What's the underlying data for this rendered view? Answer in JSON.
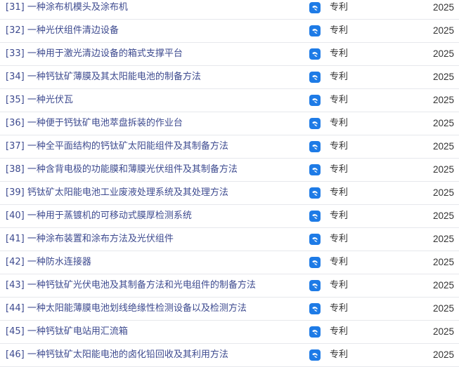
{
  "records": [
    {
      "index": "[31]",
      "title": "一种涂布机模头及涂布机",
      "type_icon": "patent-icon",
      "type": "专利",
      "year": "2025"
    },
    {
      "index": "[32]",
      "title": "一种光伏组件清边设备",
      "type_icon": "patent-icon",
      "type": "专利",
      "year": "2025"
    },
    {
      "index": "[33]",
      "title": "一种用于激光清边设备的箱式支撑平台",
      "type_icon": "patent-icon",
      "type": "专利",
      "year": "2025"
    },
    {
      "index": "[34]",
      "title": "一种钙钛矿薄膜及其太阳能电池的制备方法",
      "type_icon": "patent-icon",
      "type": "专利",
      "year": "2025"
    },
    {
      "index": "[35]",
      "title": "一种光伏瓦",
      "type_icon": "patent-icon",
      "type": "专利",
      "year": "2025"
    },
    {
      "index": "[36]",
      "title": "一种便于钙钛矿电池萃盘拆装的作业台",
      "type_icon": "patent-icon",
      "type": "专利",
      "year": "2025"
    },
    {
      "index": "[37]",
      "title": "一种全平面结构的钙钛矿太阳能组件及其制备方法",
      "type_icon": "patent-icon",
      "type": "专利",
      "year": "2025"
    },
    {
      "index": "[38]",
      "title": "一种含背电极的功能膜和薄膜光伏组件及其制备方法",
      "type_icon": "patent-icon",
      "type": "专利",
      "year": "2025"
    },
    {
      "index": "[39]",
      "title": "钙钛矿太阳能电池工业废液处理系统及其处理方法",
      "type_icon": "patent-icon",
      "type": "专利",
      "year": "2025"
    },
    {
      "index": "[40]",
      "title": "一种用于蒸镀机的可移动式膜厚检测系统",
      "type_icon": "patent-icon",
      "type": "专利",
      "year": "2025"
    },
    {
      "index": "[41]",
      "title": "一种涂布装置和涂布方法及光伏组件",
      "type_icon": "patent-icon",
      "type": "专利",
      "year": "2025"
    },
    {
      "index": "[42]",
      "title": "一种防水连接器",
      "type_icon": "patent-icon",
      "type": "专利",
      "year": "2025"
    },
    {
      "index": "[43]",
      "title": "一种钙钛矿光伏电池及其制备方法和光电组件的制备方法",
      "type_icon": "patent-icon",
      "type": "专利",
      "year": "2025"
    },
    {
      "index": "[44]",
      "title": "一种太阳能薄膜电池划线绝缘性检测设备以及检测方法",
      "type_icon": "patent-icon",
      "type": "专利",
      "year": "2025"
    },
    {
      "index": "[45]",
      "title": "一种钙钛矿电站用汇流箱",
      "type_icon": "patent-icon",
      "type": "专利",
      "year": "2025"
    },
    {
      "index": "[46]",
      "title": "一种钙钛矿太阳能电池的卤化铅回收及其利用方法",
      "type_icon": "patent-icon",
      "type": "专利",
      "year": "2025"
    }
  ],
  "colors": {
    "title_link": "#3d4a8f",
    "icon_bg": "#1e7be6",
    "divider": "#e6e8ec",
    "text": "#333333"
  }
}
